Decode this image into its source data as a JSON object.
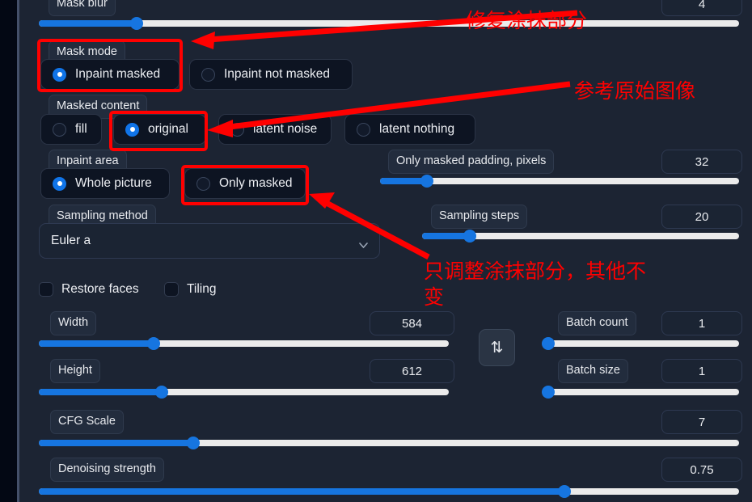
{
  "theme": {
    "panel_bg": "#1c2433",
    "page_bg": "#030814",
    "accent": "#1675e0",
    "annotation_color": "#ff0000",
    "text": "#eceef2"
  },
  "controls": {
    "mask_blur": {
      "label": "Mask blur",
      "value": "4",
      "fill_pct": 14
    },
    "mask_mode": {
      "label": "Mask mode",
      "options": [
        {
          "label": "Inpaint masked",
          "selected": true
        },
        {
          "label": "Inpaint not masked",
          "selected": false
        }
      ]
    },
    "masked_content": {
      "label": "Masked content",
      "options": [
        {
          "label": "fill",
          "selected": false
        },
        {
          "label": "original",
          "selected": true
        },
        {
          "label": "latent noise",
          "selected": false
        },
        {
          "label": "latent nothing",
          "selected": false
        }
      ]
    },
    "inpaint_area": {
      "label": "Inpaint area",
      "options": [
        {
          "label": "Whole picture",
          "selected": true
        },
        {
          "label": "Only masked",
          "selected": false
        }
      ]
    },
    "only_masked_padding": {
      "label": "Only masked padding, pixels",
      "value": "32",
      "fill_pct": 13
    },
    "sampling_method": {
      "label": "Sampling method",
      "value": "Euler a",
      "chevron": "chevron-down-icon"
    },
    "sampling_steps": {
      "label": "Sampling steps",
      "value": "20",
      "fill_pct": 15
    },
    "restore_faces": {
      "label": "Restore faces",
      "checked": false
    },
    "tiling": {
      "label": "Tiling",
      "checked": false
    },
    "width": {
      "label": "Width",
      "value": "584",
      "fill_pct": 28
    },
    "height": {
      "label": "Height",
      "value": "612",
      "fill_pct": 30
    },
    "cfg_scale": {
      "label": "CFG Scale",
      "value": "7",
      "fill_pct": 22
    },
    "denoising_strength": {
      "label": "Denoising strength",
      "value": "0.75",
      "fill_pct": 75
    },
    "batch_count": {
      "label": "Batch count",
      "value": "1",
      "fill_pct": 0
    },
    "batch_size": {
      "label": "Batch size",
      "value": "1",
      "fill_pct": 0
    },
    "swap_dimensions": {
      "icon": "swap-vertical-icon",
      "glyph": "⇅"
    }
  },
  "annotations": {
    "note_repair_masked": "修复涂抹部分",
    "note_reference_original": "参考原始图像",
    "note_only_masked_changes": "只调整涂抹部分，其他不\n变"
  }
}
